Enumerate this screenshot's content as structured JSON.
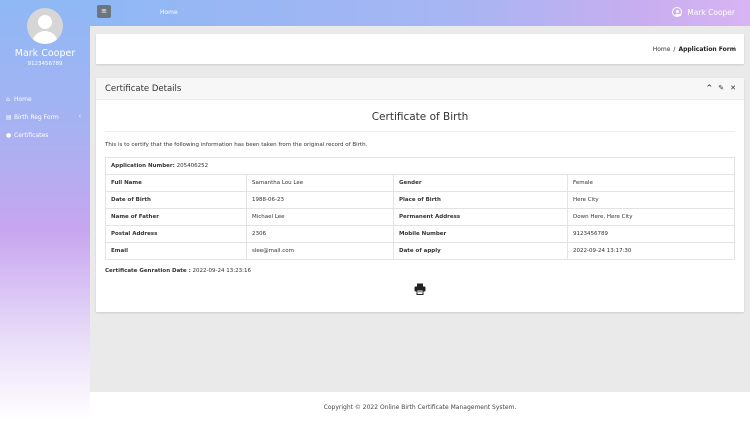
{
  "user": {
    "name": "Mark Cooper",
    "phone": "9123456789"
  },
  "sidebar": {
    "items": [
      {
        "icon": "home-icon",
        "label": "Home"
      },
      {
        "icon": "list-icon",
        "label": "Birth Reg Form"
      },
      {
        "icon": "user-icon",
        "label": "Certificates"
      }
    ]
  },
  "topbar": {
    "menu_icon": "≡",
    "home": "Home",
    "user": "Mark Cooper"
  },
  "breadcrumb": {
    "home": "Home",
    "sep": "/",
    "current": "Application Form"
  },
  "card": {
    "title": "Certificate Details",
    "tools": [
      "^",
      "✎",
      "✕"
    ],
    "certificate_title": "Certificate of Birth",
    "intro": "This is to certify that the following information has been taken from the original record of Birth.",
    "application_number_label": "Application Number:",
    "application_number": "205406252",
    "rows": [
      {
        "l1": "Full Name",
        "v1": "Samantha Lou Lee",
        "l2": "Gender",
        "v2": "Female"
      },
      {
        "l1": "Date of Birth",
        "v1": "1988-06-23",
        "l2": "Place of Birth",
        "v2": "Here City"
      },
      {
        "l1": "Name of Father",
        "v1": "Michael Lee",
        "l2": "Permanent Address",
        "v2": "Down Here, Here City"
      },
      {
        "l1": "Postal Address",
        "v1": "2306",
        "l2": "Mobile Number",
        "v2": "9123456789"
      },
      {
        "l1": "Email",
        "v1": "slee@mail.com",
        "l2": "Date of apply",
        "v2": "2022-09-24 13:17:30"
      }
    ],
    "generation_label": "Certificate Genration Date :",
    "generation_date": "2022-09-24 13:23:16"
  },
  "footer": "Copyright © 2022 Online Birth Certificate Management System."
}
